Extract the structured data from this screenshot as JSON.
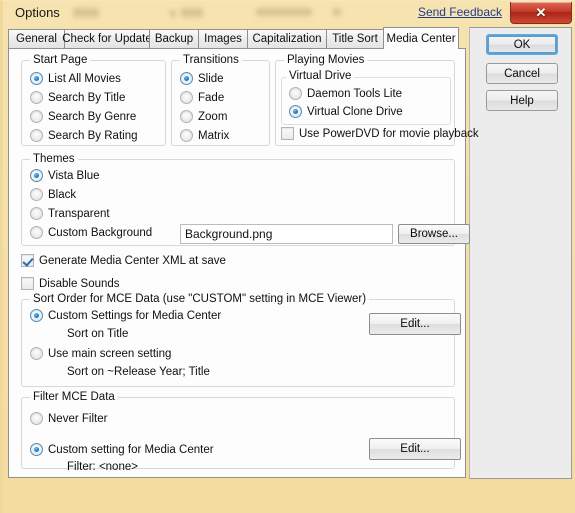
{
  "window": {
    "title": "Options",
    "send_feedback": "Send Feedback",
    "close_glyph": "✕"
  },
  "tabs": [
    {
      "label": "General",
      "active": false
    },
    {
      "label": "Check for Update",
      "active": false
    },
    {
      "label": "Backup",
      "active": false
    },
    {
      "label": "Images",
      "active": false
    },
    {
      "label": "Capitalization",
      "active": false
    },
    {
      "label": "Title Sort",
      "active": false
    },
    {
      "label": "Media Center",
      "active": true
    }
  ],
  "dialog_buttons": {
    "ok": "OK",
    "cancel": "Cancel",
    "help": "Help"
  },
  "start_page": {
    "legend": "Start Page",
    "options": [
      {
        "label": "List All Movies",
        "selected": true
      },
      {
        "label": "Search By Title",
        "selected": false
      },
      {
        "label": "Search By Genre",
        "selected": false
      },
      {
        "label": "Search By Rating",
        "selected": false
      }
    ]
  },
  "transitions": {
    "legend": "Transitions",
    "options": [
      {
        "label": "Slide",
        "selected": true
      },
      {
        "label": "Fade",
        "selected": false
      },
      {
        "label": "Zoom",
        "selected": false
      },
      {
        "label": "Matrix",
        "selected": false
      }
    ]
  },
  "playing_movies": {
    "legend": "Playing Movies",
    "virtual_drive": {
      "legend": "Virtual Drive",
      "options": [
        {
          "label": "Daemon Tools Lite",
          "selected": false
        },
        {
          "label": "Virtual Clone Drive",
          "selected": true
        }
      ]
    },
    "powerdvd": {
      "label": "Use PowerDVD for movie playback",
      "checked": false
    }
  },
  "themes": {
    "legend": "Themes",
    "options": [
      {
        "label": "Vista Blue",
        "selected": true
      },
      {
        "label": "Black",
        "selected": false
      },
      {
        "label": "Transparent",
        "selected": false
      },
      {
        "label": "Custom Background",
        "selected": false
      }
    ],
    "background_path": "Background.png",
    "background_placeholder": "",
    "browse_label": "Browse..."
  },
  "standalone_checks": [
    {
      "label": "Generate Media Center XML at save",
      "checked": true
    },
    {
      "label": "Disable Sounds",
      "checked": false
    }
  ],
  "sort_order": {
    "legend": "Sort Order for MCE Data (use \"CUSTOM\" setting in MCE Viewer)",
    "options": [
      {
        "label": "Custom Settings for Media Center",
        "selected": true,
        "detail": "Sort on Title"
      },
      {
        "label": "Use main screen setting",
        "selected": false,
        "detail": "Sort on ~Release Year; Title"
      }
    ],
    "edit_label": "Edit..."
  },
  "filter_mce": {
    "legend": "Filter MCE Data",
    "options": [
      {
        "label": "Never Filter",
        "selected": false,
        "detail": ""
      },
      {
        "label": "Custom setting for Media Center",
        "selected": true,
        "detail": "Filter: <none>"
      }
    ],
    "edit_label": "Edit..."
  },
  "colors": {
    "window_chrome": "#f5dfa6",
    "panel": "#fdfdfd",
    "accent_link": "#233b8c",
    "radio_dot": "#1878c8",
    "close_button": "#c33a27",
    "default_button_outline": "#5a9fd4"
  }
}
